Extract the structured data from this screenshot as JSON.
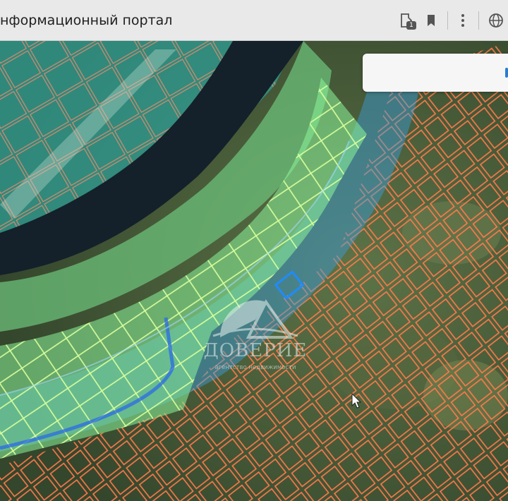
{
  "browser": {
    "tab_title": "нформационный портал",
    "badge_count": "1",
    "icons": [
      "extension-icon",
      "bookmark-icon",
      "more-icon",
      "globe-icon"
    ]
  },
  "map": {
    "parcel_outline_color": "#ff7a4a",
    "highlight_zone_color": "#7fe88f",
    "water_zone_color": "#3a9fe0",
    "selected_parcel_color": "#1e8cff",
    "river_color": "#14202a"
  },
  "watermark": {
    "brand": "ДОВЕРИЕ",
    "subtitle": "агентство недвижимости"
  }
}
